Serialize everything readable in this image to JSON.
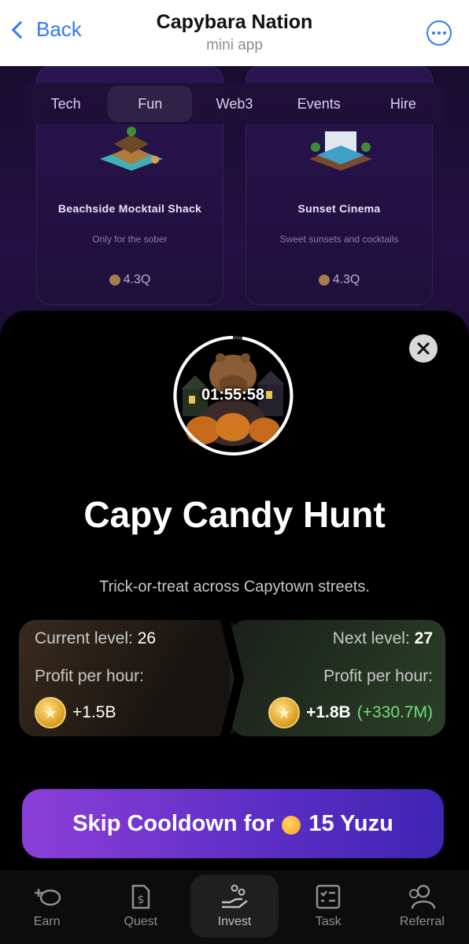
{
  "header": {
    "back_label": "Back",
    "title": "Capybara Nation",
    "subtitle": "mini app"
  },
  "background": {
    "tabs": [
      "Tech",
      "Fun",
      "Web3",
      "Events",
      "Hire"
    ],
    "active_tab": "Fun",
    "cards": [
      {
        "name": "Beachside Mocktail Shack",
        "description": "Only for the sober",
        "price": "4.3Q"
      },
      {
        "name": "Sunset Cinema",
        "description": "Sweet sunsets and cocktails",
        "price": "4.3Q"
      }
    ]
  },
  "sheet": {
    "timer": "01:55:58",
    "title": "Capy Candy Hunt",
    "description": "Trick-or-treat across Capytown streets.",
    "current": {
      "level_label": "Current level:",
      "level_value": "26",
      "profit_label": "Profit per hour:",
      "profit_value": "+1.5B"
    },
    "next": {
      "level_label": "Next level:",
      "level_value": "27",
      "profit_label": "Profit per hour:",
      "profit_value": "+1.8B",
      "profit_delta": "(+330.7M)"
    },
    "skip_button": {
      "prefix": "Skip Cooldown for",
      "suffix": "15 Yuzu"
    }
  },
  "nav": {
    "items": [
      {
        "label": "Earn",
        "icon": "earn-icon"
      },
      {
        "label": "Quest",
        "icon": "quest-icon"
      },
      {
        "label": "Invest",
        "icon": "invest-icon"
      },
      {
        "label": "Task",
        "icon": "task-icon"
      },
      {
        "label": "Referral",
        "icon": "referral-icon"
      }
    ],
    "active": "Invest"
  },
  "colors": {
    "accent_blue": "#3478f6",
    "skip_gradient_start": "#8c3fd8",
    "skip_gradient_end": "#3f24b2",
    "delta_green": "#6fe07b"
  }
}
